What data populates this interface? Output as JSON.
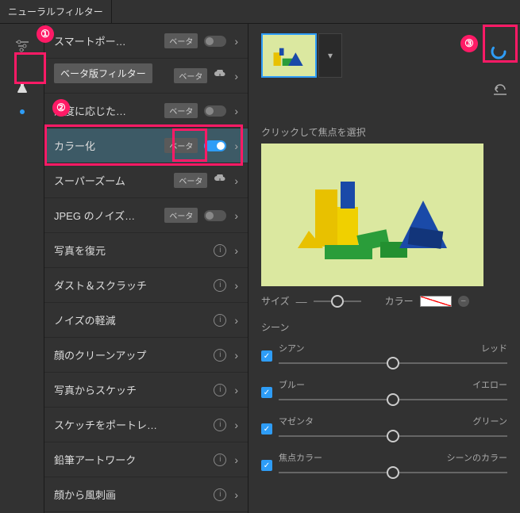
{
  "panel": {
    "title": "ニューラルフィルター"
  },
  "tooltip": "ベータ版フィルター",
  "filters": [
    {
      "label": "スマートポー…",
      "beta": true,
      "toggle": "off"
    },
    {
      "label": "スーパーズーム",
      "beta": true,
      "cloud": true,
      "hidden_index": 1
    },
    {
      "label": "深度に応じた…",
      "beta": true,
      "toggle": "off"
    },
    {
      "label": "カラー化",
      "beta": true,
      "toggle": "on",
      "selected": true
    },
    {
      "label": "スーパーズーム",
      "beta": true,
      "cloud": true
    },
    {
      "label": "JPEG のノイズ…",
      "beta": true,
      "toggle": "off"
    },
    {
      "label": "写真を復元",
      "info": true
    },
    {
      "label": "ダスト＆スクラッチ",
      "info": true
    },
    {
      "label": "ノイズの軽減",
      "info": true
    },
    {
      "label": "顔のクリーンアップ",
      "info": true
    },
    {
      "label": "写真からスケッチ",
      "info": true
    },
    {
      "label": "スケッチをポートレ…",
      "info": true
    },
    {
      "label": "鉛筆アートワーク",
      "info": true
    },
    {
      "label": "顔から風刺画",
      "info": true
    }
  ],
  "right": {
    "focal_label": "クリックして焦点を選択",
    "size_label": "サイズ",
    "color_label": "カラー",
    "scene_label": "シーン",
    "sliders": [
      {
        "left": "シアン",
        "right": "レッド"
      },
      {
        "left": "ブルー",
        "right": "イエロー"
      },
      {
        "left": "マゼンタ",
        "right": "グリーン"
      },
      {
        "left": "焦点カラー",
        "right": "シーンのカラー"
      }
    ]
  },
  "annotations": {
    "n1": "①",
    "n2": "②",
    "n3": "③"
  }
}
